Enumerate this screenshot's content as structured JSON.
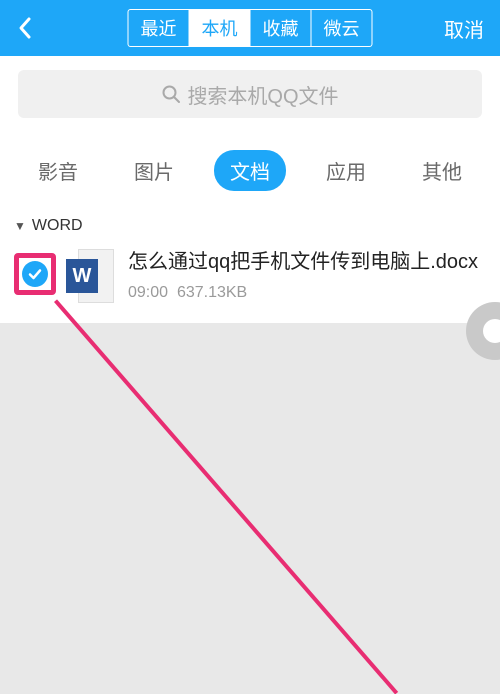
{
  "header": {
    "segments": [
      "最近",
      "本机",
      "收藏",
      "微云"
    ],
    "active_segment_index": 1,
    "cancel_label": "取消"
  },
  "search": {
    "placeholder": "搜索本机QQ文件"
  },
  "tabs": {
    "items": [
      "影音",
      "图片",
      "文档",
      "应用",
      "其他"
    ],
    "active_index": 2
  },
  "section": {
    "label": "WORD"
  },
  "files": [
    {
      "name": "怎么通过qq把手机文件传到电脑上.docx",
      "time": "09:00",
      "size": "637.13KB",
      "icon_letter": "W",
      "selected": true
    }
  ],
  "colors": {
    "primary": "#1ea7f8",
    "accent": "#e82d72",
    "word": "#2a5699"
  }
}
